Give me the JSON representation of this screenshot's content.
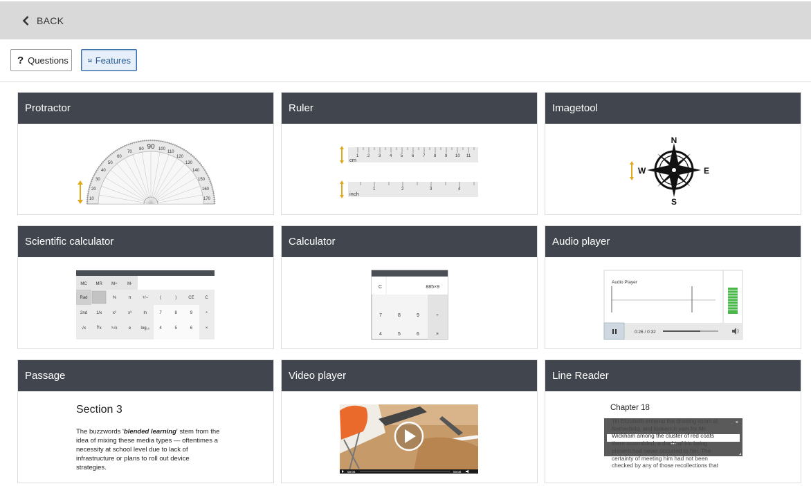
{
  "header": {
    "back_label": "BACK"
  },
  "tabs": {
    "questions_label": "Questions",
    "features_label": "Features",
    "active": "Features"
  },
  "cards": [
    {
      "title": "Protractor"
    },
    {
      "title": "Ruler"
    },
    {
      "title": "Imagetool"
    },
    {
      "title": "Scientific calculator"
    },
    {
      "title": "Calculator"
    },
    {
      "title": "Audio player"
    },
    {
      "title": "Passage"
    },
    {
      "title": "Video player"
    },
    {
      "title": "Line Reader"
    }
  ],
  "protractor": {
    "center_label": "90"
  },
  "ruler": {
    "cm_label": "cm",
    "inch_label": "inch"
  },
  "imagetool": {
    "n": "N",
    "s": "S",
    "e": "E",
    "w": "W"
  },
  "sci_calc": {
    "memory_keys": [
      "MC",
      "MR",
      "M+",
      "M-"
    ],
    "row1": [
      "Rad",
      "",
      "%",
      "π",
      "+/−",
      "(",
      ")",
      "CE",
      "C"
    ],
    "row2": [
      "2nd",
      "1/x",
      "x²",
      "x³",
      "ln",
      "7",
      "8",
      "9",
      "÷"
    ],
    "row3": [
      "√x",
      "∛x",
      "ʸ√x",
      "e",
      "log₁₀",
      "4",
      "5",
      "6",
      "×"
    ]
  },
  "calc": {
    "clear": "C",
    "display": "885×9",
    "row1": [
      "7",
      "8",
      "9",
      "÷"
    ],
    "row2": [
      "4",
      "5",
      "6",
      "×"
    ]
  },
  "audio": {
    "title": "Audio Player",
    "time": "0:26 / 0:32"
  },
  "passage": {
    "title": "Section 3",
    "text_before": "The buzzwords '",
    "text_em": "blended learning",
    "text_after": "' stem from the idea of mixing these media types — oftentimes a necessity at school level due to lack of infrastructure or plans to roll out device strategies."
  },
  "video": {
    "time_start": "00:00",
    "time_end": "00:00"
  },
  "line_reader": {
    "chapter": "Chapter 18",
    "lines": [
      "Till Elizabeth entered the drawing-room at",
      "Netherfield, and looked in vain for Mr.",
      "Wickham among the cluster of red coats",
      "there assembled, a doubt of his being",
      "present had never occurred to her. The",
      "certainty of meeting him had not been",
      "checked by any of those recollections that"
    ]
  },
  "colors": {
    "card_header": "#41464e",
    "accent_arrow": "#e0a81a",
    "active_tab": "#2a5d95"
  }
}
